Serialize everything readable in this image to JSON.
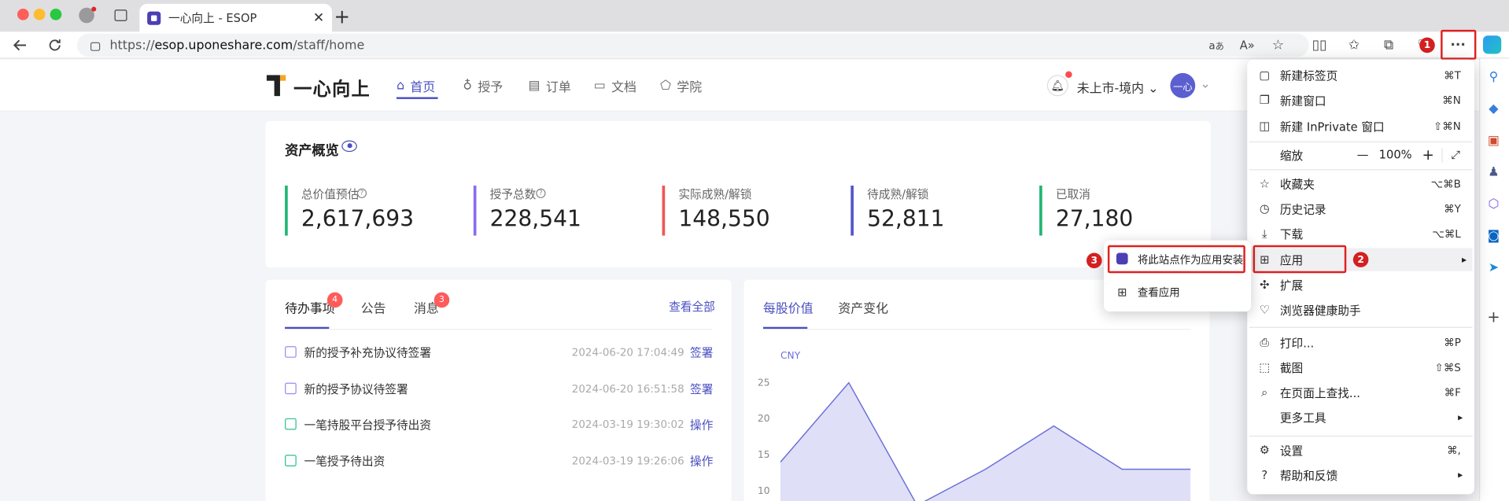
{
  "browser": {
    "tab_title": "一心向上 - ESOP",
    "url_prefix": "https://",
    "url_host": "esop.uponeshare.com",
    "url_path": "/staff/home",
    "new_tab_symbol": "+",
    "tab_close_symbol": "✕",
    "more_symbol": "···"
  },
  "site": {
    "logo_text": "一心向上",
    "nav": [
      {
        "label": "首页",
        "icon": "home-icon"
      },
      {
        "label": "授予",
        "icon": "gift-icon"
      },
      {
        "label": "订单",
        "icon": "order-icon"
      },
      {
        "label": "文档",
        "icon": "folder-icon"
      },
      {
        "label": "学院",
        "icon": "academy-icon"
      }
    ],
    "market": "未上市-境内",
    "avatar": "一心"
  },
  "assets": {
    "title": "资产概览",
    "stats": [
      {
        "label": "总价值预估",
        "value": "2,617,693",
        "color": "#22b573"
      },
      {
        "label": "授予总数",
        "value": "228,541",
        "color": "#8b6cf0"
      },
      {
        "label": "实际成熟/解锁",
        "value": "148,550",
        "color": "#f05656"
      },
      {
        "label": "待成熟/解锁",
        "value": "52,811",
        "color": "#5257c9"
      },
      {
        "label": "已取消",
        "value": "27,180",
        "color": "#22b573"
      }
    ]
  },
  "todo": {
    "tabs": [
      {
        "label": "待办事项",
        "badge": "4"
      },
      {
        "label": "公告",
        "badge": ""
      },
      {
        "label": "消息",
        "badge": "3"
      }
    ],
    "view_all": "查看全部",
    "items": [
      {
        "title": "新的授予补充协议待签署",
        "date": "2024-06-20 17:04:49",
        "action": "签署",
        "icon": "sign-icon"
      },
      {
        "title": "新的授予协议待签署",
        "date": "2024-06-20 16:51:58",
        "action": "签署",
        "icon": "sign-icon"
      },
      {
        "title": "一笔持股平台授予待出资",
        "date": "2024-03-19 19:30:02",
        "action": "操作",
        "icon": "calendar-icon"
      },
      {
        "title": "一笔授予待出资",
        "date": "2024-03-19 19:26:06",
        "action": "操作",
        "icon": "calendar-icon"
      }
    ]
  },
  "chart_panel": {
    "tabs": [
      "每股价值",
      "资产变化"
    ]
  },
  "chart_data": {
    "type": "area",
    "ylabel": "CNY",
    "yticks": [
      25,
      20,
      15,
      10
    ],
    "ylim": [
      7,
      27
    ],
    "values": [
      14,
      25,
      8,
      13,
      19,
      13,
      13
    ],
    "color": "#6c6fd8"
  },
  "menu": {
    "items": [
      {
        "label": "新建标签页",
        "shortcut": "⌘T",
        "icon": "new-tab-icon"
      },
      {
        "label": "新建窗口",
        "shortcut": "⌘N",
        "icon": "new-window-icon"
      },
      {
        "label": "新建 InPrivate 窗口",
        "shortcut": "⇧⌘N",
        "icon": "inprivate-icon"
      },
      {
        "label": "收藏夹",
        "shortcut": "⌥⌘B",
        "icon": "favorites-icon"
      },
      {
        "label": "历史记录",
        "shortcut": "⌘Y",
        "icon": "history-icon"
      },
      {
        "label": "下载",
        "shortcut": "⌥⌘L",
        "icon": "download-icon"
      },
      {
        "label": "应用",
        "shortcut": "",
        "icon": "apps-icon"
      },
      {
        "label": "扩展",
        "shortcut": "",
        "icon": "extensions-icon"
      },
      {
        "label": "浏览器健康助手",
        "shortcut": "",
        "icon": "health-icon"
      },
      {
        "label": "打印...",
        "shortcut": "⌘P",
        "icon": "print-icon"
      },
      {
        "label": "截图",
        "shortcut": "⇧⌘S",
        "icon": "screenshot-icon"
      },
      {
        "label": "在页面上查找...",
        "shortcut": "⌘F",
        "icon": "find-icon"
      },
      {
        "label": "更多工具",
        "shortcut": "",
        "icon": "tools-icon"
      },
      {
        "label": "设置",
        "shortcut": "⌘,",
        "icon": "settings-icon"
      },
      {
        "label": "帮助和反馈",
        "shortcut": "",
        "icon": "help-icon"
      }
    ],
    "zoom_label": "缩放",
    "zoom_value": "100%",
    "zoom_minus": "—",
    "zoom_plus": "+"
  },
  "submenu": {
    "items": [
      {
        "label": "将此站点作为应用安装",
        "icon": "site-app-icon"
      },
      {
        "label": "查看应用",
        "icon": "view-apps-icon"
      }
    ]
  },
  "annotations": [
    "1",
    "2",
    "3"
  ]
}
